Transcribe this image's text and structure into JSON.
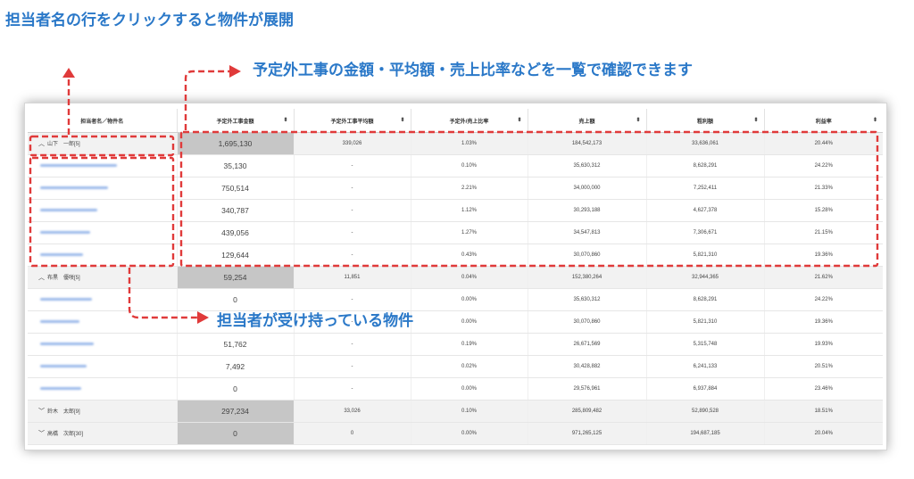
{
  "annotations": {
    "title_top": "担当者名の行をクリックすると物件が展開",
    "title_right": "予定外工事の金額・平均額・売上比率などを一覧で確認できます",
    "title_mid": "担当者が受け持っている物件"
  },
  "colors": {
    "callout": "#2a78c8",
    "highlight": "#e03a3a",
    "group_shade": "#c6c6c6"
  },
  "table": {
    "columns": [
      {
        "label": "担当者名／物件名",
        "sortable": false
      },
      {
        "label": "予定外工事金額",
        "sortable": true
      },
      {
        "label": "予定外工事平均額",
        "sortable": true
      },
      {
        "label": "予定外/売上比率",
        "sortable": true
      },
      {
        "label": "売上額",
        "sortable": true
      },
      {
        "label": "粗利額",
        "sortable": true
      },
      {
        "label": "利益率",
        "sortable": true
      }
    ],
    "sort_icon": "sort-icon",
    "rows": [
      {
        "type": "group",
        "expanded": true,
        "name": "山下　一郎[5]",
        "cells": [
          "1,695,130",
          "339,026",
          "1.03%",
          "184,542,173",
          "33,636,061",
          "20.44%"
        ]
      },
      {
        "type": "item",
        "cells": [
          "35,130",
          "-",
          "0.10%",
          "35,630,312",
          "8,628,291",
          "24.22%"
        ]
      },
      {
        "type": "item",
        "cells": [
          "750,514",
          "-",
          "2.21%",
          "34,000,000",
          "7,252,411",
          "21.33%"
        ]
      },
      {
        "type": "item",
        "cells": [
          "340,787",
          "-",
          "1.12%",
          "30,293,188",
          "4,627,378",
          "15.28%"
        ]
      },
      {
        "type": "item",
        "cells": [
          "439,056",
          "-",
          "1.27%",
          "34,547,813",
          "7,306,671",
          "21.15%"
        ]
      },
      {
        "type": "item",
        "cells": [
          "129,644",
          "-",
          "0.43%",
          "30,070,860",
          "5,821,310",
          "19.36%"
        ]
      },
      {
        "type": "group",
        "expanded": true,
        "name": "布黒　優咲[5]",
        "cells": [
          "59,254",
          "11,851",
          "0.04%",
          "152,380,264",
          "32,944,365",
          "21.62%"
        ]
      },
      {
        "type": "item",
        "cells": [
          "0",
          "-",
          "0.00%",
          "35,630,312",
          "8,628,291",
          "24.22%"
        ]
      },
      {
        "type": "item",
        "cells": [
          "",
          "-",
          "0.00%",
          "30,070,860",
          "5,821,310",
          "19.36%"
        ]
      },
      {
        "type": "item",
        "cells": [
          "51,762",
          "-",
          "0.19%",
          "26,671,569",
          "5,315,748",
          "19.93%"
        ]
      },
      {
        "type": "item",
        "cells": [
          "7,492",
          "-",
          "0.02%",
          "30,428,882",
          "6,241,133",
          "20.51%"
        ]
      },
      {
        "type": "item",
        "cells": [
          "0",
          "-",
          "0.00%",
          "29,576,961",
          "6,937,884",
          "23.46%"
        ]
      },
      {
        "type": "group",
        "expanded": false,
        "name": "鈴木　太郎[9]",
        "cells": [
          "297,234",
          "33,026",
          "0.10%",
          "285,809,482",
          "52,890,528",
          "18.51%"
        ]
      },
      {
        "type": "group",
        "expanded": false,
        "name": "高橋　次郎[30]",
        "cells": [
          "0",
          "0",
          "0.00%",
          "971,265,125",
          "194,687,185",
          "20.04%"
        ]
      }
    ]
  }
}
